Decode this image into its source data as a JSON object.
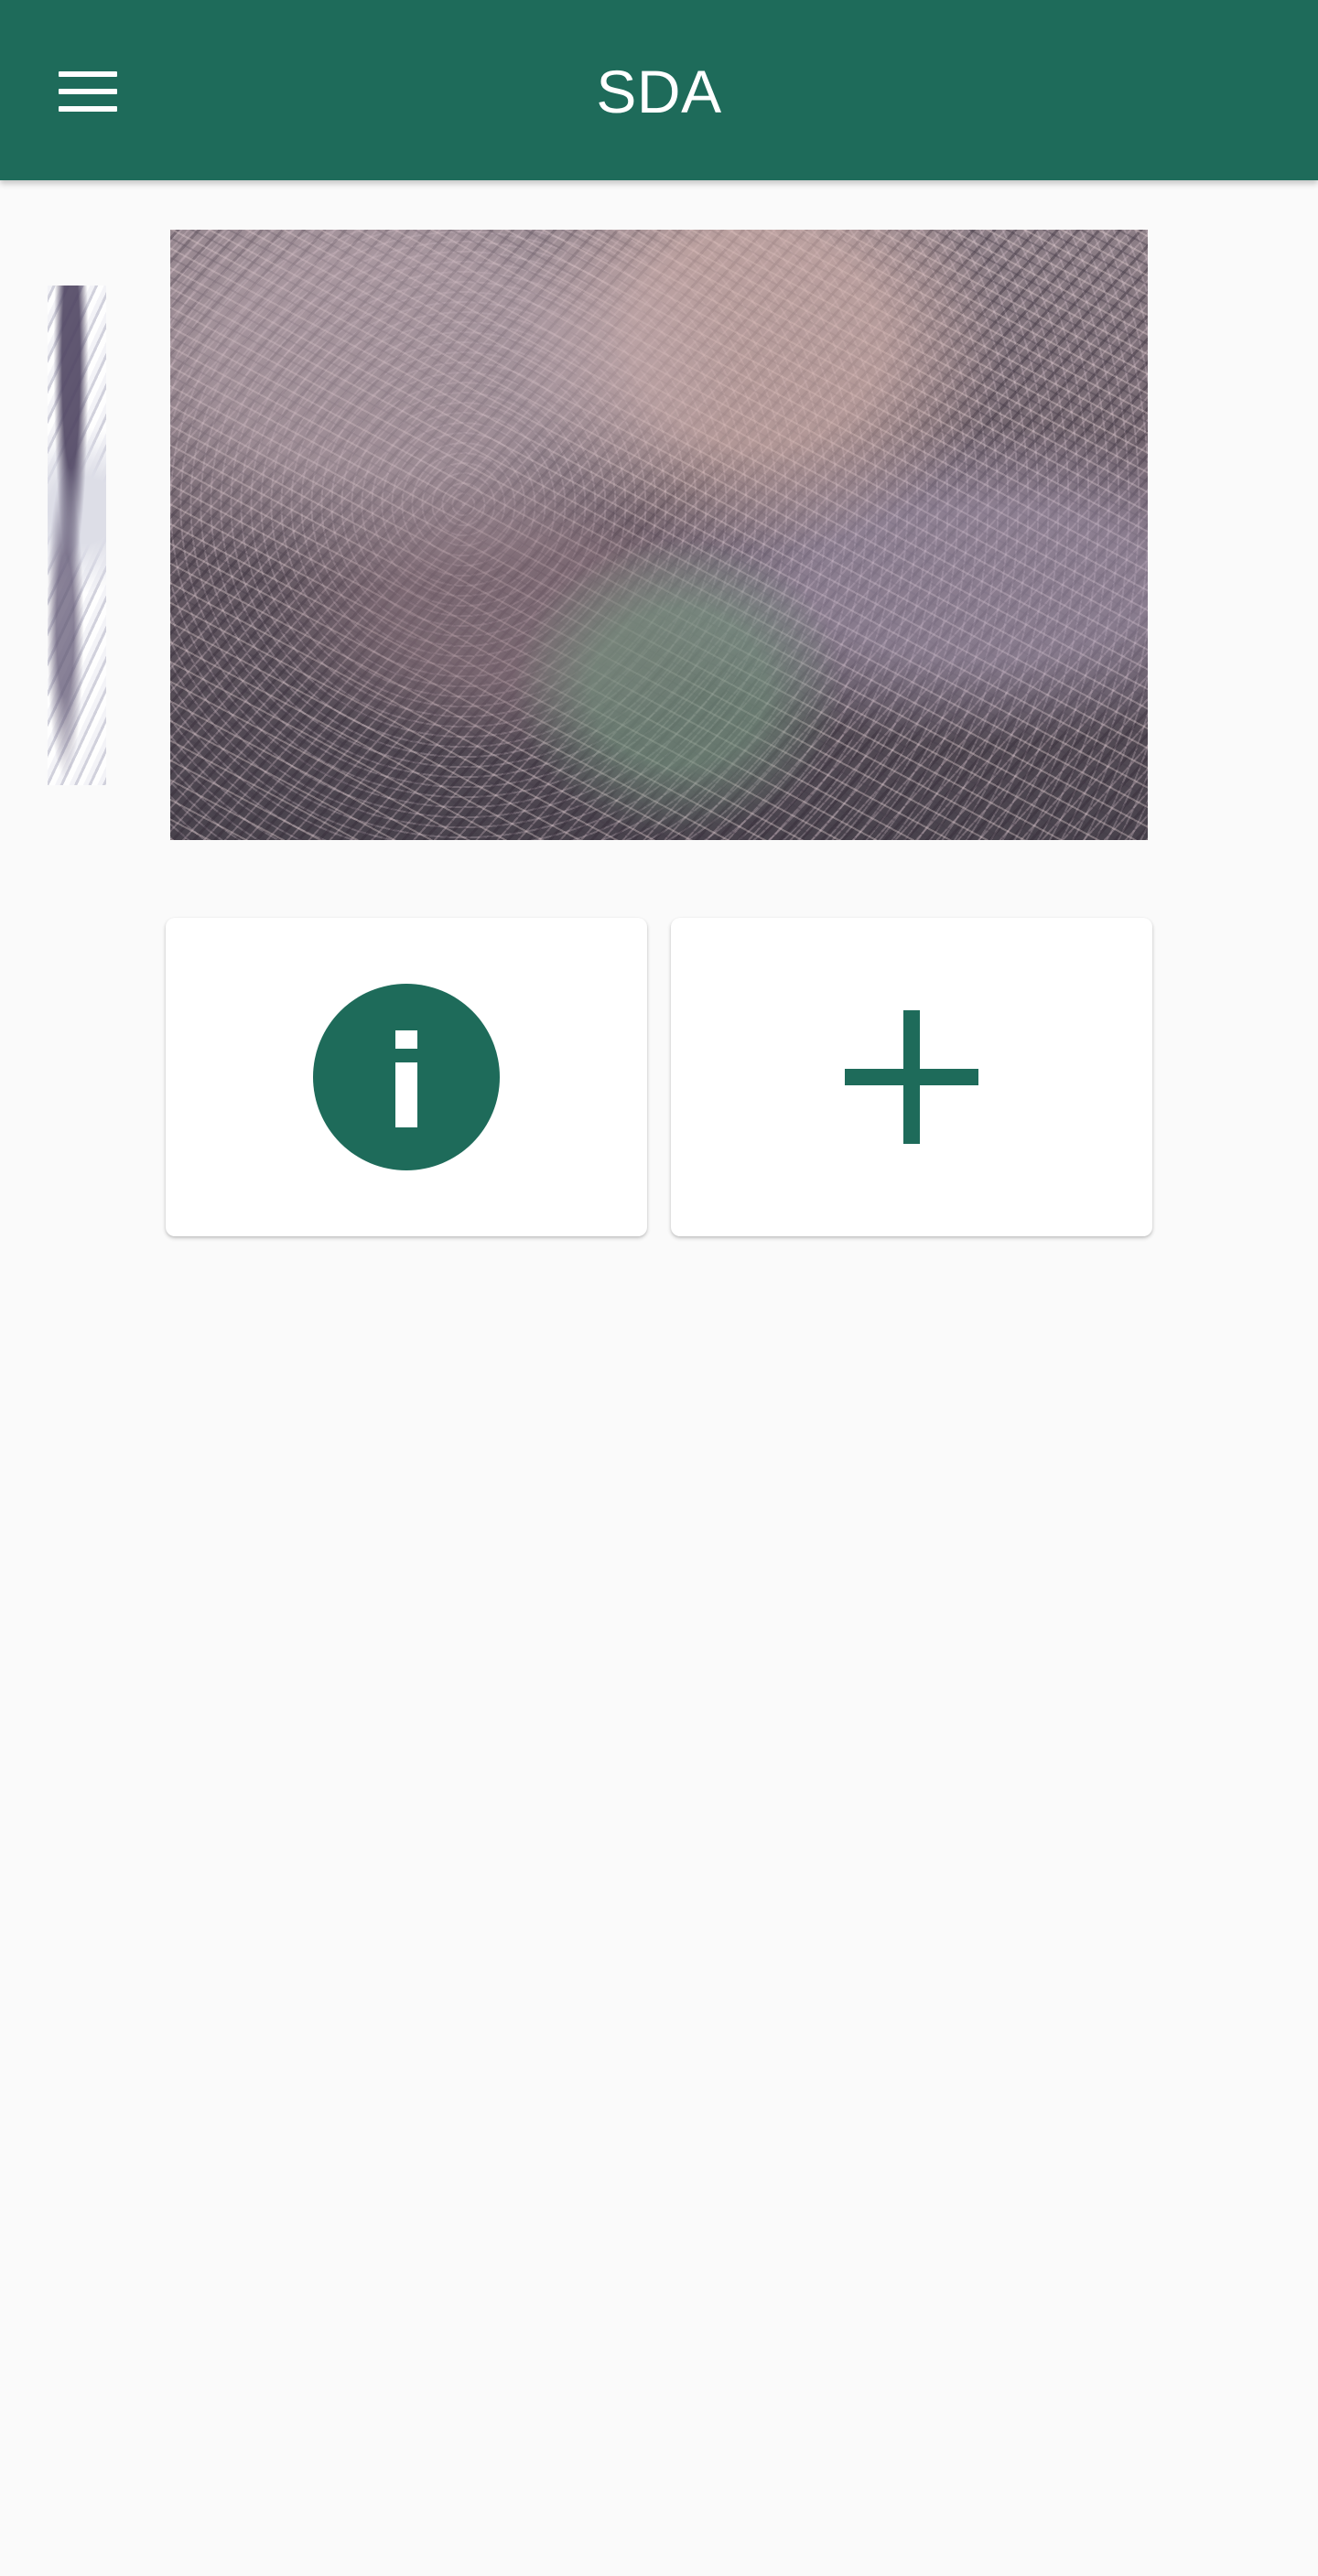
{
  "app": {
    "title": "SDA"
  },
  "toolbar": {
    "menu_icon": "menu-icon"
  },
  "images": {
    "hero": "root-mass-photo",
    "thumbnail": "partial-thumbnail"
  },
  "actions": {
    "info_icon": "info-icon",
    "add_icon": "plus-icon"
  },
  "colors": {
    "brand": "#1e6b5a",
    "background": "#fafafa",
    "card": "#ffffff",
    "icon_foreground": "#ffffff"
  }
}
